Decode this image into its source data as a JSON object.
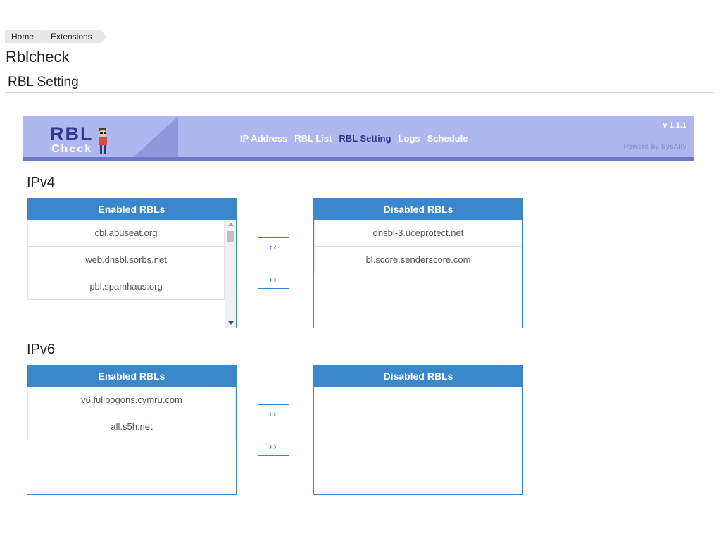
{
  "breadcrumb": {
    "home": "Home",
    "extensions": "Extensions"
  },
  "page_title": "Rblcheck",
  "section_title": "RBL Setting",
  "banner": {
    "logo_top": "RBL",
    "logo_bottom": "Check",
    "nav": [
      "IP Address",
      "RBL List",
      "RBL Setting",
      "Logs",
      "Schedule"
    ],
    "active_nav": "RBL Setting",
    "version": "v 1.1.1",
    "powered": "Powerd by SysAlly"
  },
  "ipv4": {
    "heading": "IPv4",
    "enabled_title": "Enabled RBLs",
    "enabled": [
      "cbl.abuseat.org",
      "web.dnsbl.sorbs.net",
      "pbl.spamhaus.org"
    ],
    "disabled_title": "Disabled RBLs",
    "disabled": [
      "dnsbl-3.uceprotect.net",
      "bl.score.senderscore.com"
    ],
    "move_left": "‹‹",
    "move_right": "››"
  },
  "ipv6": {
    "heading": "IPv6",
    "enabled_title": "Enabled RBLs",
    "enabled": [
      "v6.fullbogons.cymru.com",
      "all.s5h.net"
    ],
    "disabled_title": "Disabled RBLs",
    "disabled": [],
    "move_left": "‹‹",
    "move_right": "››"
  },
  "colors": {
    "accent": "#3a87cc",
    "banner": "#aeb8ee",
    "banner_dark": "#2f3a8f"
  }
}
